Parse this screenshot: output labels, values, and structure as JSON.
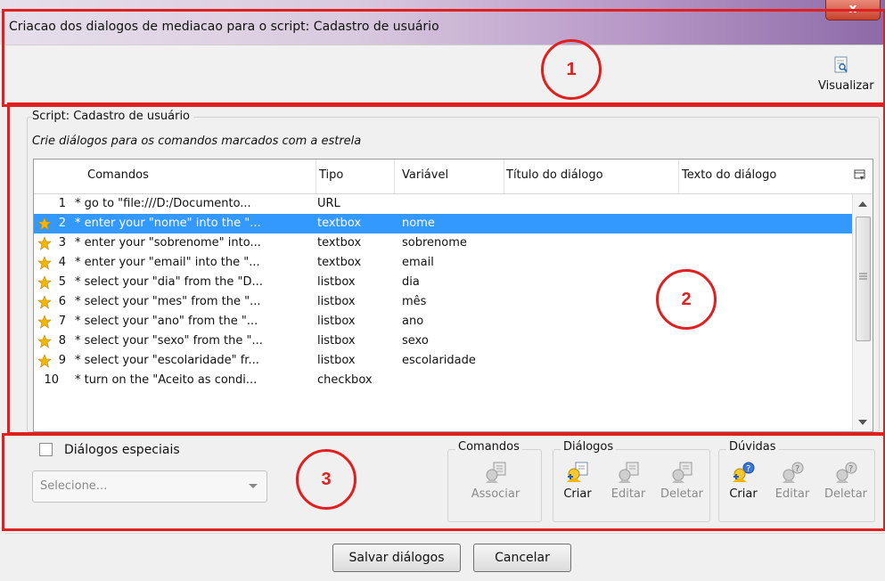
{
  "window": {
    "title": "Criacao dos dialogos de mediacao para o script: Cadastro de usuário",
    "close": "x"
  },
  "toolbar": {
    "preview_label": "Visualizar"
  },
  "annotations": {
    "one": "1",
    "two": "2",
    "three": "3"
  },
  "script": {
    "label": "Script: Cadastro de usuário",
    "hint": "Crie diálogos para os comandos marcados com a estrela"
  },
  "table": {
    "columns": [
      "Comandos",
      "Tipo",
      "Variável",
      "Título do diálogo",
      "Texto do diálogo"
    ],
    "rows": [
      {
        "num": "1",
        "cmd": "* go to \"file:///D:/Documento...",
        "type": "URL",
        "var": "",
        "starred": false,
        "selected": false
      },
      {
        "num": "2",
        "cmd": "* enter your \"nome\" into the \"...",
        "type": "textbox",
        "var": "nome",
        "starred": true,
        "selected": true
      },
      {
        "num": "3",
        "cmd": "* enter your \"sobrenome\" into...",
        "type": "textbox",
        "var": "sobrenome",
        "starred": true,
        "selected": false
      },
      {
        "num": "4",
        "cmd": "* enter your \"email\" into the \"...",
        "type": "textbox",
        "var": "email",
        "starred": true,
        "selected": false
      },
      {
        "num": "5",
        "cmd": "* select your \"dia\" from the \"D...",
        "type": "listbox",
        "var": "dia",
        "starred": true,
        "selected": false
      },
      {
        "num": "6",
        "cmd": "* select your \"mes\" from the \"...",
        "type": "listbox",
        "var": "mês",
        "starred": true,
        "selected": false
      },
      {
        "num": "7",
        "cmd": "* select your \"ano\" from the \"...",
        "type": "listbox",
        "var": "ano",
        "starred": true,
        "selected": false
      },
      {
        "num": "8",
        "cmd": "* select your \"sexo\" from the \"...",
        "type": "listbox",
        "var": "sexo",
        "starred": true,
        "selected": false
      },
      {
        "num": "9",
        "cmd": "* select your \"escolaridade\" fr...",
        "type": "listbox",
        "var": "escolaridade",
        "starred": true,
        "selected": false
      },
      {
        "num": "10",
        "cmd": "* turn on the \"Aceito as condi...",
        "type": "checkbox",
        "var": "",
        "starred": false,
        "selected": false
      }
    ]
  },
  "special": {
    "checkbox_label": "Diálogos especiais",
    "checked": false,
    "select_placeholder": "Selecione..."
  },
  "groups": {
    "comandos": {
      "legend": "Comandos",
      "associar": "Associar"
    },
    "dialogos": {
      "legend": "Diálogos",
      "criar": "Criar",
      "editar": "Editar",
      "deletar": "Deletar"
    },
    "duvidas": {
      "legend": "Dúvidas",
      "criar": "Criar",
      "editar": "Editar",
      "deletar": "Deletar"
    }
  },
  "footer": {
    "save": "Salvar diálogos",
    "cancel": "Cancelar"
  },
  "colors": {
    "selection": "#3399ff",
    "annotation": "#e02020",
    "star": "#f2b705"
  }
}
